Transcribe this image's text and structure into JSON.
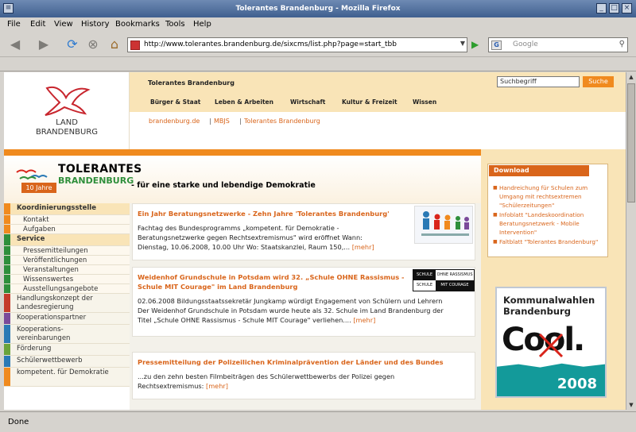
{
  "window": {
    "title": "Tolerantes Brandenburg - Mozilla Firefox"
  },
  "menu": [
    "File",
    "Edit",
    "View",
    "History",
    "Bookmarks",
    "Tools",
    "Help"
  ],
  "address": {
    "url": "http://www.tolerantes.brandenburg.de/sixcms/list.php?page=start_tbb"
  },
  "search": {
    "placeholder": "Google"
  },
  "status": "Done",
  "page": {
    "logo": {
      "line1": "LAND",
      "line2": "BRANDENBURG"
    },
    "site_name": "Tolerantes Brandenburg",
    "search_placeholder": "Suchbegriff",
    "search_button": "Suche",
    "nav": [
      "Bürger & Staat",
      "Leben & Arbeiten",
      "Wirtschaft",
      "Kultur & Freizeit",
      "Wissen"
    ],
    "breadcrumb": [
      "brandenburg.de",
      "MBJS",
      "Tolerantes Brandenburg"
    ],
    "brand": {
      "line1": "TOLERANTES",
      "line2": "BRANDENBURG",
      "badge": "10 Jahre",
      "tagline": "- für eine starke und lebendige Demokratie"
    },
    "leftnav": [
      {
        "label": "Koordinierungsstelle",
        "level": 0,
        "bar": "#f08a1e"
      },
      {
        "label": "Kontakt",
        "level": 1,
        "bar": "#f08a1e"
      },
      {
        "label": "Aufgaben",
        "level": 1,
        "bar": "#f08a1e"
      },
      {
        "label": "Service",
        "level": 0,
        "bar": "#2f8f3b"
      },
      {
        "label": "Pressemitteilungen",
        "level": 1,
        "bar": "#2f8f3b"
      },
      {
        "label": "Veröffentlichungen",
        "level": 1,
        "bar": "#2f8f3b"
      },
      {
        "label": "Veranstaltungen",
        "level": 1,
        "bar": "#2f8f3b"
      },
      {
        "label": "Wissenswertes",
        "level": 1,
        "bar": "#2f8f3b"
      },
      {
        "label": "Ausstellungsangebote",
        "level": 1,
        "bar": "#2f8f3b"
      },
      {
        "label": "Handlungskonzept der Landesregierung",
        "level": 0,
        "bar": "#c43a2a"
      },
      {
        "label": "Kooperationspartner",
        "level": 0,
        "bar": "#7a4a9a"
      },
      {
        "label": "Kooperations-vereinbarungen",
        "level": 0,
        "bar": "#2a79b5"
      },
      {
        "label": "Förderung",
        "level": 0,
        "bar": "#6aa33a"
      },
      {
        "label": "Schülerwettbewerb",
        "level": 0,
        "bar": "#2a79b5"
      },
      {
        "label": "kompetent. für Demokratie",
        "level": 0,
        "bar": "#f08a1e"
      }
    ],
    "news": [
      {
        "title": "Ein Jahr Beratungsnetzwerke - Zehn Jahre 'Tolerantes Brandenburg'",
        "body": [
          "Fachtag des Bundesprogramms „kompetent. für Demokratie -",
          "Beratungsnetzwerke gegen Rechtsextremismus\" wird eröffnet Wann:",
          "Dienstag, 10.06.2008, 10.00 Uhr Wo:          Staatskanzlei, Raum 150,..."
        ],
        "more": "[mehr]"
      },
      {
        "title": "Weidenhof Grundschule in Potsdam wird 32. „Schule OHNE Rassismus -",
        "title2": "Schule MIT Courage\" im Land Brandenburg",
        "body": [
          "02.06.2008  Bildungsstaatssekretär Jungkamp würdigt Engagement von Schülern und Lehrern",
          "Der Weidenhof Grundschule in Potsdam wurde heute als 32. Schule im Land Brandenburg der",
          "Titel „Schule OHNE Rassismus - Schule MIT Courage\" verliehen...."
        ],
        "more": "[mehr]"
      },
      {
        "title": "Pressemitteilung der Polizeilichen Kriminalprävention der Länder und des Bundes",
        "body": [
          "...zu den zehn besten Filmbeiträgen des Schülerwettbewerbs der Polizei gegen",
          "Rechtsextremismus:"
        ],
        "more": "[mehr]"
      }
    ],
    "thumb2": {
      "r1a": "SCHULE",
      "r1b": "OHNE RASSISMUS",
      "r2a": "SCHULE",
      "r2b": "MIT COURAGE"
    },
    "download": {
      "title": "Download",
      "items": [
        "Handreichung für Schulen zum Umgang mit rechtsextremen \"Schülerzeitungen\"",
        "Infoblatt \"Landeskoordination Beratungsnetzwerk - Mobile Intervention\"",
        "Faltblatt \"Tolerantes Brandenburg\""
      ]
    },
    "wahl": {
      "line1": "Kommunalwahlen",
      "line2": "Brandenburg",
      "word": "Cool.",
      "year": "2008"
    }
  }
}
